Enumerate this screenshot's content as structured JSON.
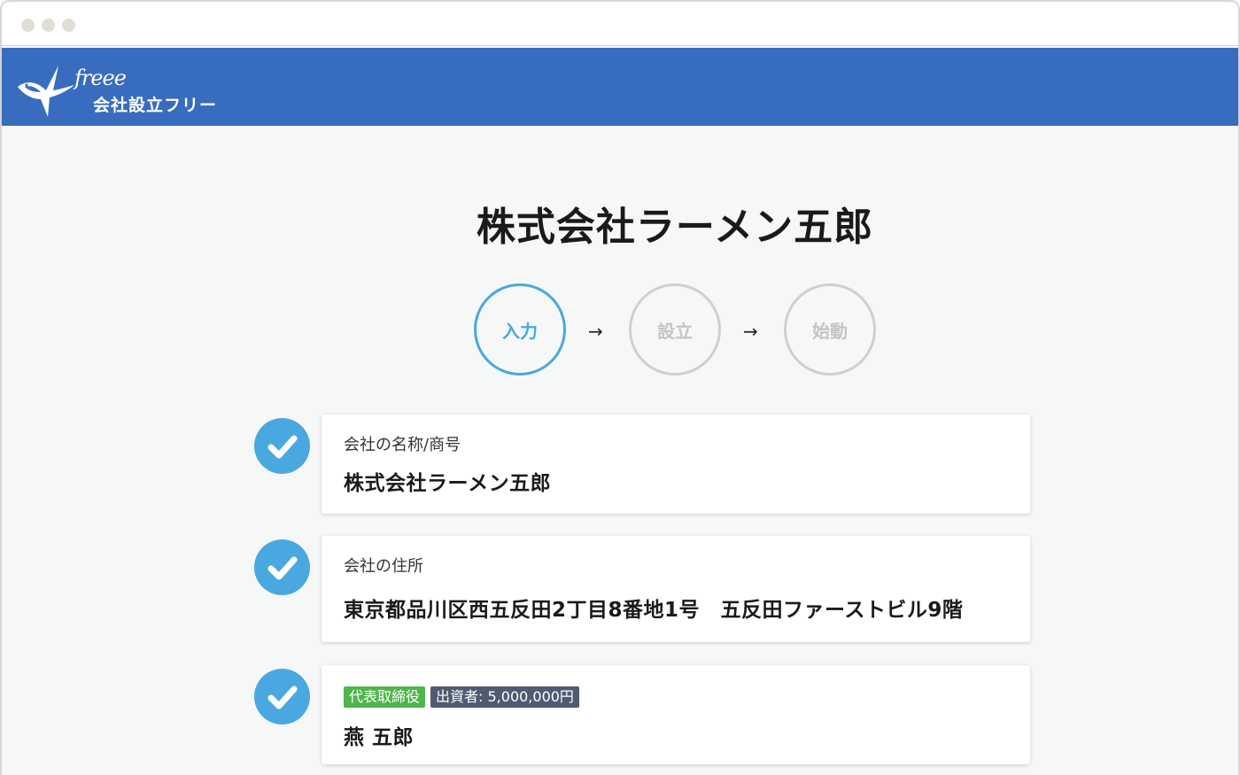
{
  "brand": {
    "wordmark": "freee",
    "service_name": "会社設立フリー",
    "color": "#386cbf"
  },
  "company_title": "株式会社ラーメン五郎",
  "steps": [
    {
      "label": "入力",
      "state": "active"
    },
    {
      "label": "設立",
      "state": "inactive"
    },
    {
      "label": "始動",
      "state": "inactive"
    }
  ],
  "step_arrow": "→",
  "cards": [
    {
      "label": "会社の名称/商号",
      "value": "株式会社ラーメン五郎",
      "checked": true
    },
    {
      "label": "会社の住所",
      "value": "東京都品川区西五反田2丁目8番地1号　五反田ファーストビル9階",
      "checked": true
    },
    {
      "badges": [
        "代表取締役",
        "出資者: 5,000,000円"
      ],
      "value": "燕 五郎",
      "checked": true
    }
  ],
  "colors": {
    "accent": "#4aa8e0",
    "badge_role": "#4fb54d",
    "badge_investor": "#4f5b71"
  }
}
